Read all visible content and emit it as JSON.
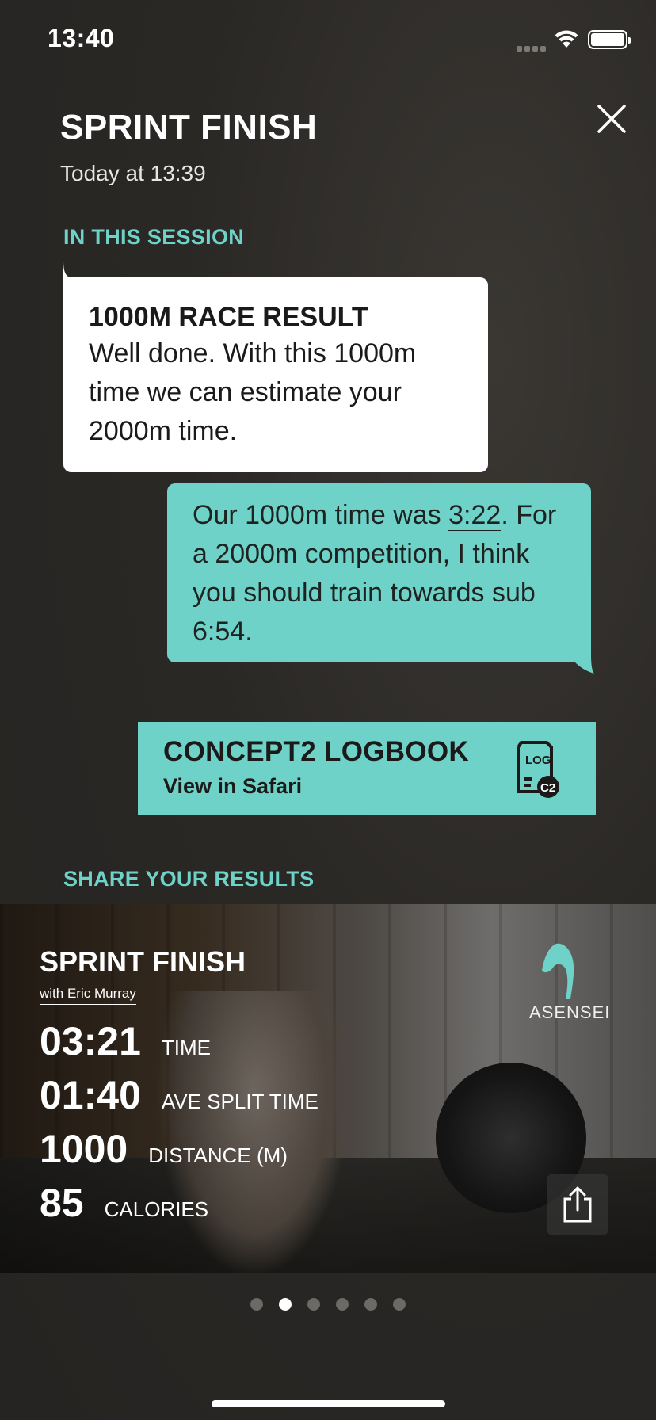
{
  "status_bar": {
    "time": "13:40"
  },
  "header": {
    "title": "SPRINT FINISH",
    "subtitle": "Today at 13:39"
  },
  "session": {
    "section_label": "IN THIS SESSION",
    "message_in": {
      "heading": "1000M RACE RESULT",
      "body": "Well done. With this 1000m time we can estimate your 2000m time."
    },
    "message_out": {
      "line1_prefix": "Our 1000m time was ",
      "time_value": "3:22",
      "line1_suffix": ". For a 2000m competition, I think you should train towards sub ",
      "target_value": "6:54",
      "end": "."
    },
    "logbook": {
      "title": "CONCEPT2 LOGBOOK",
      "subtitle": "View in Safari",
      "icon": "log-c2-icon"
    }
  },
  "share": {
    "section_label": "SHARE YOUR RESULTS",
    "card": {
      "title": "SPRINT FINISH",
      "with": "with Eric Murray",
      "brand": "ASENSEI",
      "stats": [
        {
          "value": "03:21",
          "label": "TIME"
        },
        {
          "value": "01:40",
          "label": "AVE SPLIT TIME"
        },
        {
          "value": "1000",
          "label": "DISTANCE (M)"
        },
        {
          "value": "85",
          "label": "CALORIES"
        }
      ]
    }
  },
  "pager": {
    "count": 6,
    "active_index": 1
  },
  "colors": {
    "accent": "#6fd2c8",
    "background": "#2a2825"
  }
}
